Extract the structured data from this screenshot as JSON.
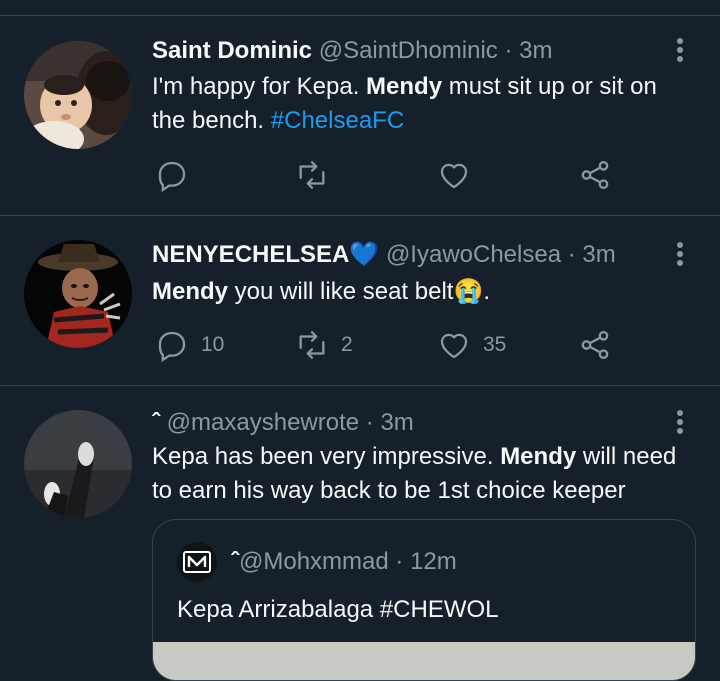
{
  "colors": {
    "background": "#15202b",
    "text": "#f7f9f9",
    "muted": "#8b98a5",
    "link": "#1d9bf0",
    "border": "#38444d"
  },
  "tweets": [
    {
      "name": "Saint Dominic",
      "handle": "@SaintDhominic",
      "sep": "·",
      "time": "3m",
      "text_a": "I'm happy for Kepa. ",
      "bold": "Mendy",
      "text_b": " must sit up or sit on the bench. ",
      "hashtag": "#ChelseaFC",
      "replies": "",
      "retweets": "",
      "likes": ""
    },
    {
      "name": "NENYECHELSEA",
      "name_emoji": "💙",
      "handle": "@IyawoChelsea",
      "sep": "·",
      "time": "3m",
      "bold": "Mendy",
      "text_b": " you will like seat belt",
      "text_emoji": "😭",
      "text_c": ".",
      "replies": "10",
      "retweets": "2",
      "likes": "35"
    },
    {
      "name": "ˆ",
      "handle": "@maxayshewrote",
      "sep": "·",
      "time": "3m",
      "text_a": "Kepa has been very impressive. ",
      "bold": "Mendy",
      "text_b": " will need to earn his way back to be 1st choice keeper",
      "quote": {
        "avatar_icon": "M-logo-icon",
        "name": "ˆ",
        "handle": "@Mohxmmad",
        "sep": "·",
        "time": "12m",
        "text": "Kepa Arrizabalaga #CHEWOL"
      }
    }
  ]
}
